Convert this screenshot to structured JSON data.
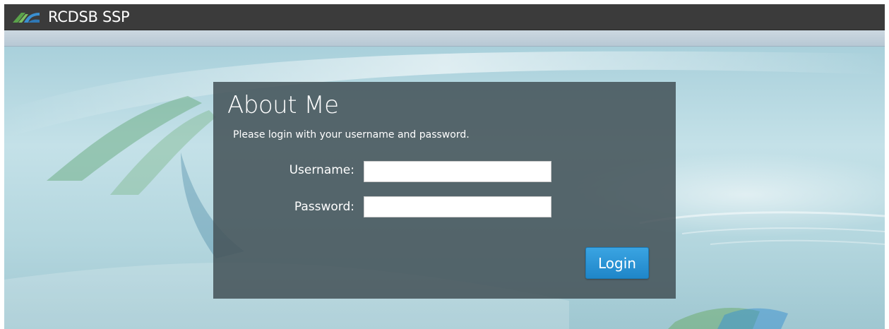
{
  "header": {
    "app_title": "RCDSB SSP",
    "logo_icon": "rcdsb-logo-icon",
    "bar_color": "#3b3b3b"
  },
  "login_panel": {
    "title": "About Me",
    "subtitle": "Please login with your username and password.",
    "username_label": "Username:",
    "username_value": "",
    "password_label": "Password:",
    "password_value": "",
    "login_button_label": "Login",
    "button_color": "#2b95d6"
  },
  "colors": {
    "background": "#b3d6de",
    "panel": "#46545a",
    "logo_green": "#5aa24a",
    "logo_blue": "#3a8fd0"
  }
}
